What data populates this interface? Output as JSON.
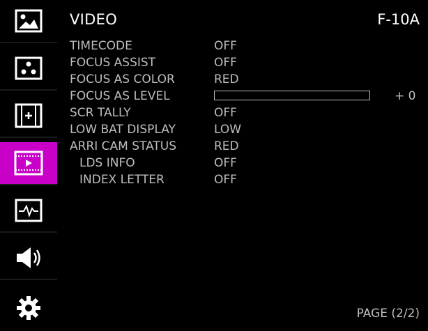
{
  "header": {
    "title": "VIDEO",
    "model": "F-10A"
  },
  "sidebar": {
    "items": [
      {
        "icon": "image-icon",
        "active": false
      },
      {
        "icon": "dots-icon",
        "active": false
      },
      {
        "icon": "frame-plus-icon",
        "active": false
      },
      {
        "icon": "film-play-icon",
        "active": true
      },
      {
        "icon": "waveform-icon",
        "active": false
      },
      {
        "icon": "speaker-icon",
        "active": false
      },
      {
        "icon": "gear-icon",
        "active": false
      }
    ],
    "active_color": "#c800c8"
  },
  "menu": {
    "rows": [
      {
        "label": "TIMECODE",
        "value": "OFF"
      },
      {
        "label": "FOCUS ASSIST",
        "value": "OFF"
      },
      {
        "label": "FOCUS AS COLOR",
        "value": "RED"
      },
      {
        "label": "FOCUS AS LEVEL",
        "value": "+ 0",
        "level_fraction": 0
      },
      {
        "label": "SCR TALLY",
        "value": "OFF"
      },
      {
        "label": "LOW BAT DISPLAY",
        "value": "LOW"
      },
      {
        "label": "ARRI CAM STATUS",
        "value": "RED"
      },
      {
        "label": "LDS INFO",
        "value": "OFF"
      },
      {
        "label": "INDEX LETTER",
        "value": "OFF"
      }
    ]
  },
  "footer": {
    "page": "PAGE (2/2)"
  }
}
